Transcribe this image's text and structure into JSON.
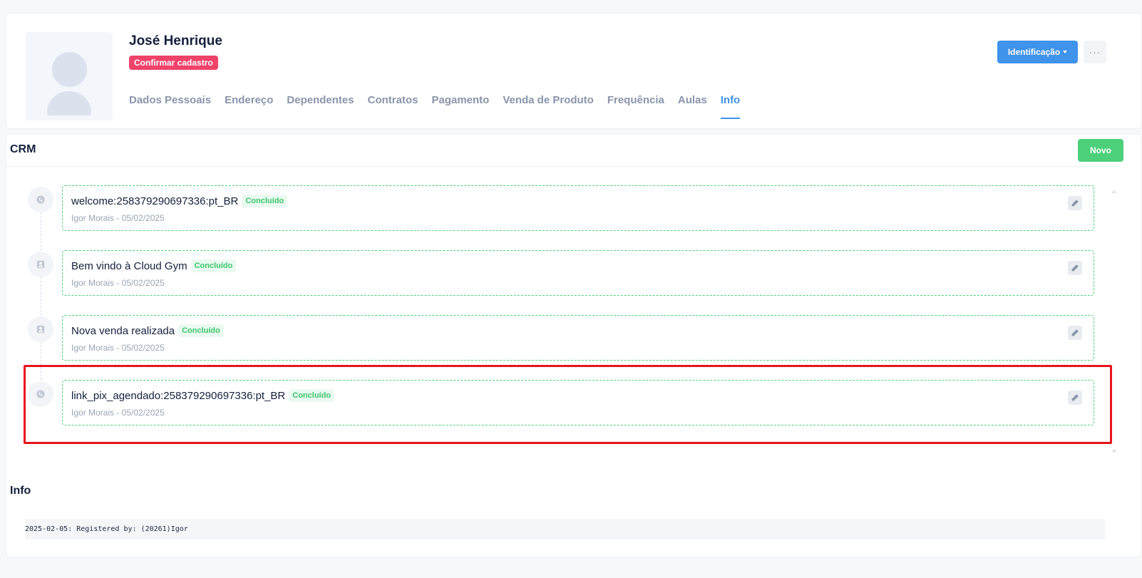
{
  "profile": {
    "name": "José Henrique",
    "status_badge": "Confirmar cadastro",
    "tabs": [
      {
        "label": "Dados Pessoais",
        "active": false
      },
      {
        "label": "Endereço",
        "active": false
      },
      {
        "label": "Dependentes",
        "active": false
      },
      {
        "label": "Contratos",
        "active": false
      },
      {
        "label": "Pagamento",
        "active": false
      },
      {
        "label": "Venda de Produto",
        "active": false
      },
      {
        "label": "Frequência",
        "active": false
      },
      {
        "label": "Aulas",
        "active": false
      },
      {
        "label": "Info",
        "active": true
      }
    ],
    "identification_button": "Identificação",
    "more_button": "···"
  },
  "crm": {
    "title": "CRM",
    "new_button": "Novo",
    "items": [
      {
        "title": "welcome:258379290697336:pt_BR",
        "status": "Concluído",
        "meta": "Igor Morais - 05/02/2025",
        "icon": "whatsapp-icon"
      },
      {
        "title": "Bem vindo à Cloud Gym",
        "status": "Concluído",
        "meta": "Igor Morais - 05/02/2025",
        "icon": "user-icon"
      },
      {
        "title": "Nova venda realizada",
        "status": "Concluído",
        "meta": "Igor Morais - 05/02/2025",
        "icon": "user-icon"
      },
      {
        "title": "link_pix_agendado:258379290697336:pt_BR",
        "status": "Concluído",
        "meta": "Igor Morais - 05/02/2025",
        "icon": "whatsapp-icon"
      }
    ]
  },
  "info": {
    "title": "Info",
    "log": "2025-02-05: Registered by: (20261)Igor"
  },
  "colors": {
    "accent": "#3f93ea",
    "success": "#4cd07a",
    "danger": "#f0436a",
    "highlight": "#e8141b"
  }
}
